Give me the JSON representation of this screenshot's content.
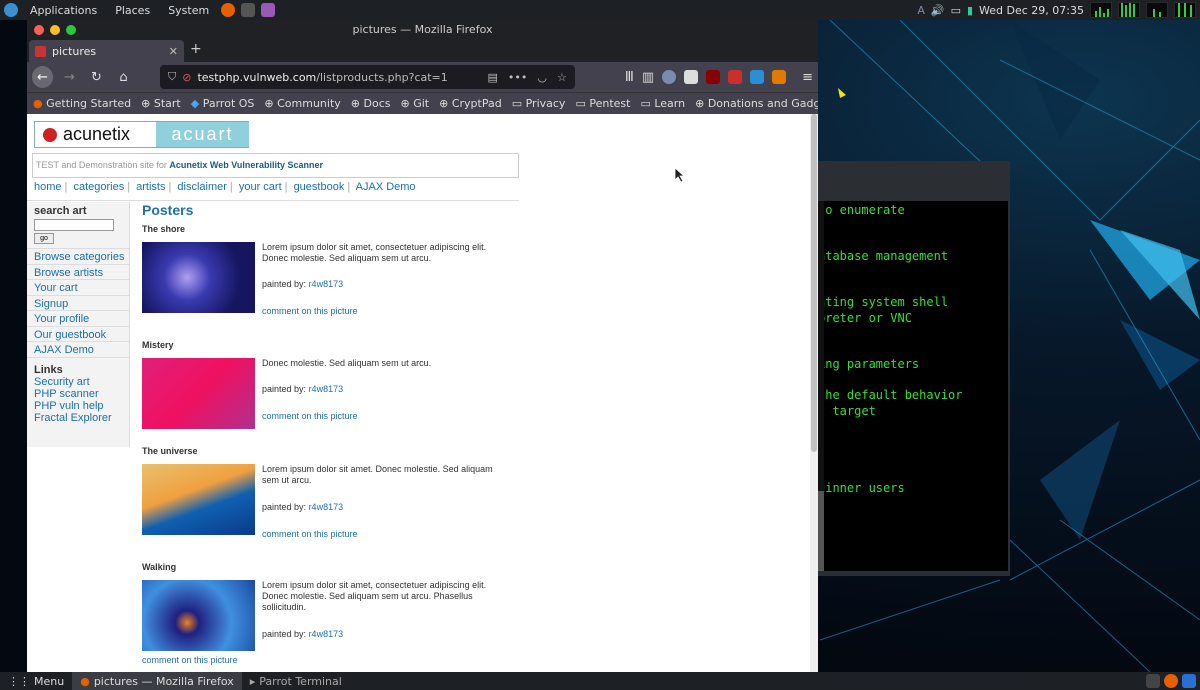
{
  "top_panel": {
    "apps": "Applications",
    "places": "Places",
    "system": "System",
    "datetime": "Wed Dec 29, 07:35"
  },
  "terminal": {
    "lines": [
      "to enumerate",
      "atabase management",
      "ating system shell",
      "preter or VNC",
      "ing parameters",
      "the default behavior",
      "t target",
      "ginner users"
    ]
  },
  "firefox": {
    "window_title": "pictures — Mozilla Firefox",
    "tab_label": "pictures",
    "url_host": "testphp.vulnweb.com",
    "url_path": "/listproducts.php?cat=1",
    "bookmarks": [
      "Getting Started",
      "Start",
      "Parrot OS",
      "Community",
      "Docs",
      "Git",
      "CryptPad",
      "Privacy",
      "Pentest",
      "Learn",
      "Donations and Gadgets"
    ]
  },
  "page": {
    "logo_left": "acunetix",
    "logo_right": "acuart",
    "subtitle": "TEST and Demonstration site for",
    "subtitle_link": "Acunetix Web Vulnerability Scanner",
    "nav": [
      "home",
      "categories",
      "artists",
      "disclaimer",
      "your cart",
      "guestbook",
      "AJAX Demo"
    ],
    "search_label": "search art",
    "go": "go",
    "side_links": [
      "Browse categories",
      "Browse artists",
      "Your cart",
      "Signup",
      "Your profile",
      "Our guestbook",
      "AJAX Demo"
    ],
    "links_title": "Links",
    "ext_links": [
      "Security art",
      "PHP scanner",
      "PHP vuln help",
      "Fractal Explorer"
    ],
    "heading": "Posters",
    "painted_by": "painted by:",
    "artist": "r4w8173",
    "comment": "comment on this picture",
    "items": [
      {
        "title": "The shore",
        "desc": "Lorem ipsum dolor sit amet, consectetuer adipiscing elit. Donec molestie. Sed aliquam sem ut arcu."
      },
      {
        "title": "Mistery",
        "desc": "Donec molestie. Sed aliquam sem ut arcu."
      },
      {
        "title": "The universe",
        "desc": "Lorem ipsum dolor sit amet. Donec molestie. Sed aliquam sem ut arcu."
      },
      {
        "title": "Walking",
        "desc": "Lorem ipsum dolor sit amet, consectetuer adipiscing elit. Donec molestie. Sed aliquam sem ut arcu. Phasellus sollicitudin."
      }
    ]
  },
  "taskbar": {
    "menu": "Menu",
    "firefox": "pictures — Mozilla Firefox",
    "terminal": "Parrot Terminal"
  }
}
